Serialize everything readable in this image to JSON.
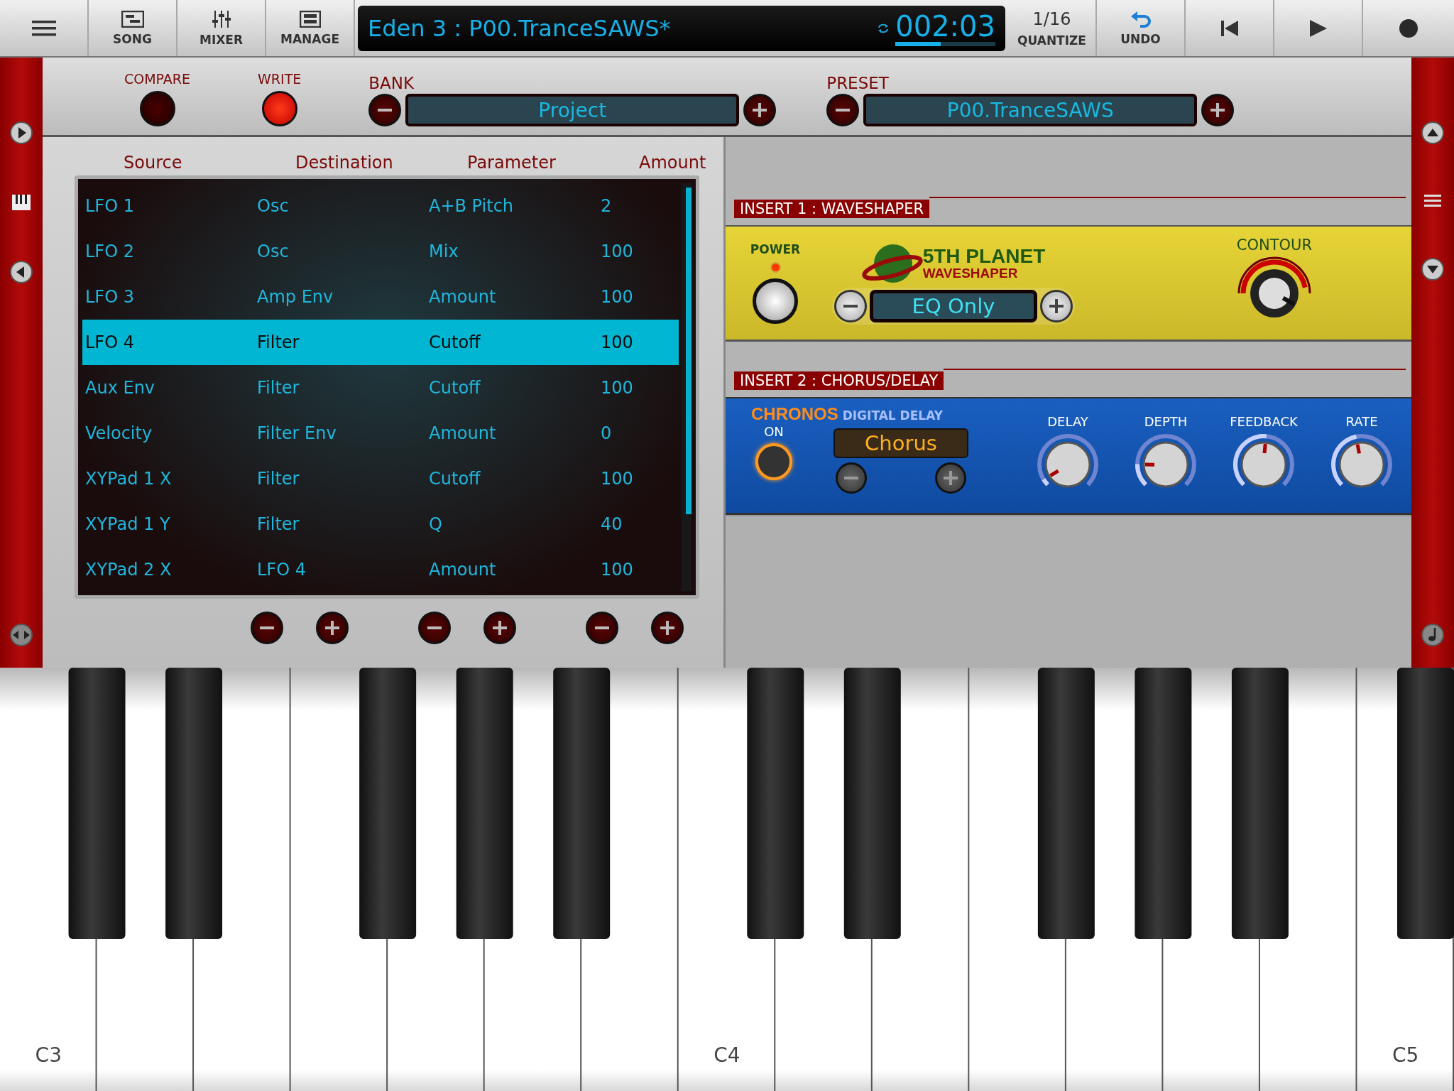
{
  "top_bar": {
    "buttons": [
      "SONG",
      "MIXER",
      "MANAGE"
    ],
    "display": {
      "title": "Eden 3 : P00.TranceSAWS*",
      "time": "002:03",
      "progress": {
        "level": 0.45
      }
    },
    "quantize": {
      "value": "1/16",
      "label": "QUANTIZE"
    },
    "undo": {
      "label": "UNDO"
    }
  },
  "preset_bar": {
    "compare": {
      "label": "COMPARE",
      "on": false
    },
    "write": {
      "label": "WRITE",
      "on": true
    },
    "bank": {
      "label": "BANK",
      "value": "Project"
    },
    "preset": {
      "label": "PRESET",
      "value": "P00.TranceSAWS"
    }
  },
  "mod_matrix": {
    "columns": [
      "Source",
      "Destination",
      "Parameter",
      "Amount"
    ],
    "rows": [
      {
        "source": "LFO 1",
        "destination": "Osc",
        "parameter": "A+B Pitch",
        "amount": "2",
        "selected": false
      },
      {
        "source": "LFO 2",
        "destination": "Osc",
        "parameter": "Mix",
        "amount": "100",
        "selected": false
      },
      {
        "source": "LFO 3",
        "destination": "Amp Env",
        "parameter": "Amount",
        "amount": "100",
        "selected": false
      },
      {
        "source": "LFO 4",
        "destination": "Filter",
        "parameter": "Cutoff",
        "amount": "100",
        "selected": true
      },
      {
        "source": "Aux Env",
        "destination": "Filter",
        "parameter": "Cutoff",
        "amount": "100",
        "selected": false
      },
      {
        "source": "Velocity",
        "destination": "Filter Env",
        "parameter": "Amount",
        "amount": "0",
        "selected": false
      },
      {
        "source": "XYPad 1 X",
        "destination": "Filter",
        "parameter": "Cutoff",
        "amount": "100",
        "selected": false
      },
      {
        "source": "XYPad 1 Y",
        "destination": "Filter",
        "parameter": "Q",
        "amount": "40",
        "selected": false
      },
      {
        "source": "XYPad 2 X",
        "destination": "LFO 4",
        "parameter": "Amount",
        "amount": "100",
        "selected": false
      }
    ]
  },
  "insert_1": {
    "header": "INSERT 1 : WAVESHAPER",
    "power_label": "POWER",
    "power_on": true,
    "brand": "5TH PLANET",
    "product": "WAVESHAPER",
    "mode": "EQ Only",
    "contour": {
      "label": "CONTOUR",
      "level": 0.94
    }
  },
  "insert_2": {
    "header": "INSERT 2 : CHORUS/DELAY",
    "brand": "CHRONOS",
    "product": "DIGITAL DELAY",
    "on_label": "ON",
    "on": true,
    "mode": "Chorus",
    "knobs": [
      {
        "label": "DELAY",
        "level": 0.05
      },
      {
        "label": "DEPTH",
        "level": 0.17
      },
      {
        "label": "FEEDBACK",
        "level": 0.52
      },
      {
        "label": "RATE",
        "level": 0.46
      }
    ]
  },
  "keyboard": {
    "labels": [
      "C3",
      "C4",
      "C5"
    ]
  }
}
